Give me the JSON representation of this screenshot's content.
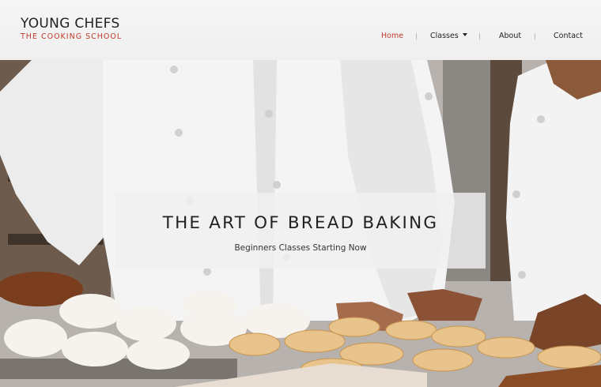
{
  "brand": {
    "title": "YOUNG CHEFS",
    "subtitle": "THE COOKING SCHOOL",
    "accent_color": "#c0392b"
  },
  "nav": {
    "items": [
      {
        "label": "Home",
        "active": true
      },
      {
        "label": "Classes",
        "has_dropdown": true,
        "icon": "caret-down-icon"
      },
      {
        "label": "About"
      },
      {
        "label": "Contact"
      }
    ]
  },
  "hero": {
    "title": "THE ART OF BREAD BAKING",
    "subtitle": "Beginners Classes Starting Now"
  }
}
